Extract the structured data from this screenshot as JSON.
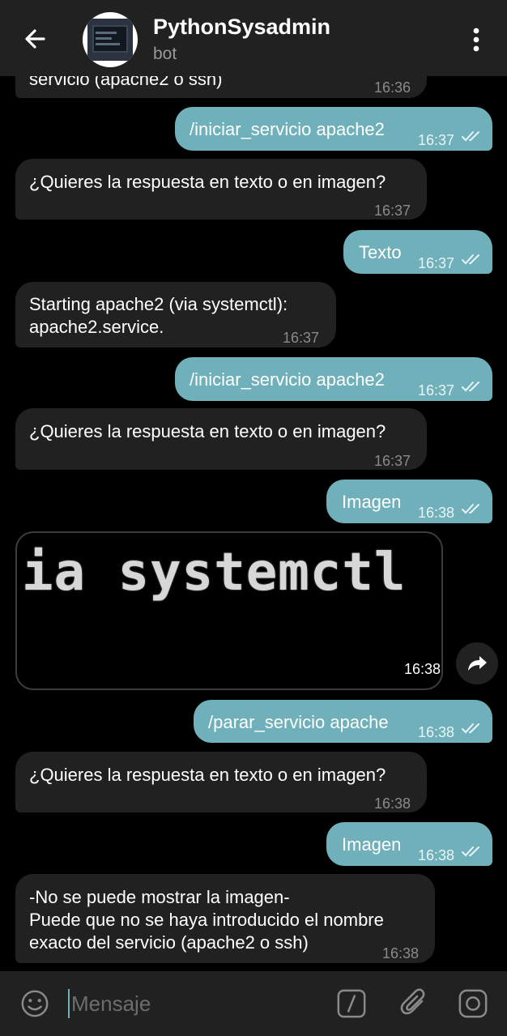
{
  "header": {
    "title": "PythonSysadmin",
    "subtitle": "bot"
  },
  "messages": [
    {
      "dir": "in",
      "text": "servicio (apache2 o ssh)",
      "time": "16:36"
    },
    {
      "dir": "out",
      "text": "/iniciar_servicio apache2",
      "time": "16:37",
      "read": true
    },
    {
      "dir": "in",
      "text": "¿Quieres la respuesta en texto o en imagen?",
      "time": "16:37"
    },
    {
      "dir": "out",
      "text": "Texto",
      "time": "16:37",
      "read": true
    },
    {
      "dir": "in",
      "text": "Starting apache2 (via systemctl):\napache2.service.",
      "time": "16:37"
    },
    {
      "dir": "out",
      "text": "/iniciar_servicio apache2",
      "time": "16:37",
      "read": true
    },
    {
      "dir": "in",
      "text": "¿Quieres la respuesta en texto o en imagen?",
      "time": "16:37"
    },
    {
      "dir": "out",
      "text": "Imagen",
      "time": "16:38",
      "read": true
    },
    {
      "dir": "in",
      "type": "photo",
      "text": "ia systemctl",
      "time": "16:38"
    },
    {
      "dir": "out",
      "text": "/parar_servicio apache",
      "time": "16:38",
      "read": true
    },
    {
      "dir": "in",
      "text": "¿Quieres la respuesta en texto o en imagen?",
      "time": "16:38"
    },
    {
      "dir": "out",
      "text": "Imagen",
      "time": "16:38",
      "read": true
    },
    {
      "dir": "in",
      "text": "-No se puede mostrar la imagen-\nPuede que no se haya introducido el nombre\nexacto del servicio (apache2 o ssh)",
      "time": "16:38"
    }
  ],
  "composer": {
    "placeholder": "Mensaje"
  },
  "icons": {
    "back": "arrow-left-icon",
    "menu": "more-vertical-icon",
    "share": "share-icon",
    "emoji": "emoji-icon",
    "commands": "slash-command-icon",
    "attach": "paperclip-icon",
    "camera": "instagram-camera-icon",
    "ticks": "double-check-icon"
  },
  "colors": {
    "incoming_bubble": "#212121",
    "outgoing_bubble": "#6fb0ba",
    "background": "#000000",
    "header": "#212121"
  }
}
